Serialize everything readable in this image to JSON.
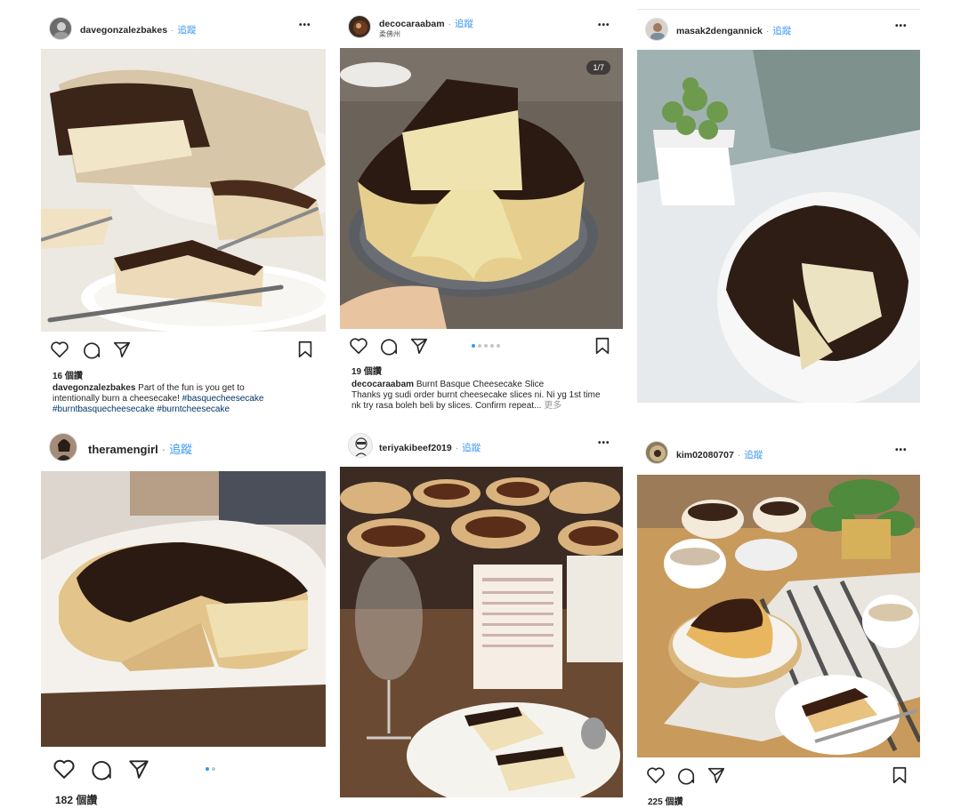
{
  "posts": [
    {
      "username": "davegonzalezbakes",
      "follow": "追蹤",
      "likes": "16 個讚",
      "caption_user": "davegonzalezbakes",
      "caption_text": "Part of the fun is you get to intentionally burn a cheesecake!",
      "hashtags": "#basquecheesecake #burntbasquecheesecake #burntcheesecake"
    },
    {
      "username": "decocaraabam",
      "follow": "追蹤",
      "location": "柔佛州",
      "counter": "1/7",
      "likes": "19 個讚",
      "caption_user": "decocaraabam",
      "caption_title": "Burnt Basque Cheesecake Slice",
      "caption_text": "Thanks yg sudi order burnt cheesecake slices ni. Ni yg 1st time nk try rasa boleh beli by slices. Confirm repeat...",
      "more": "更多"
    },
    {
      "username": "masak2dengannick",
      "follow": "追蹤"
    },
    {
      "username": "theramengirl",
      "follow": "追蹤",
      "likes": "182 個讚"
    },
    {
      "username": "teriyakibeef2019",
      "follow": "追蹤"
    },
    {
      "username": "kim02080707",
      "follow": "追蹤",
      "likes": "225 個讚"
    }
  ],
  "ui": {
    "more_glyph": "•••",
    "dot_sep": "·"
  },
  "colors": {
    "follow_blue": "#3897f0",
    "hashtag": "#003569",
    "cake_burnt": "#2a1a12",
    "cake_custard": "#e9dcb6"
  },
  "icons": [
    "heart-icon",
    "comment-icon",
    "share-icon",
    "bookmark-icon",
    "more-options-icon"
  ]
}
